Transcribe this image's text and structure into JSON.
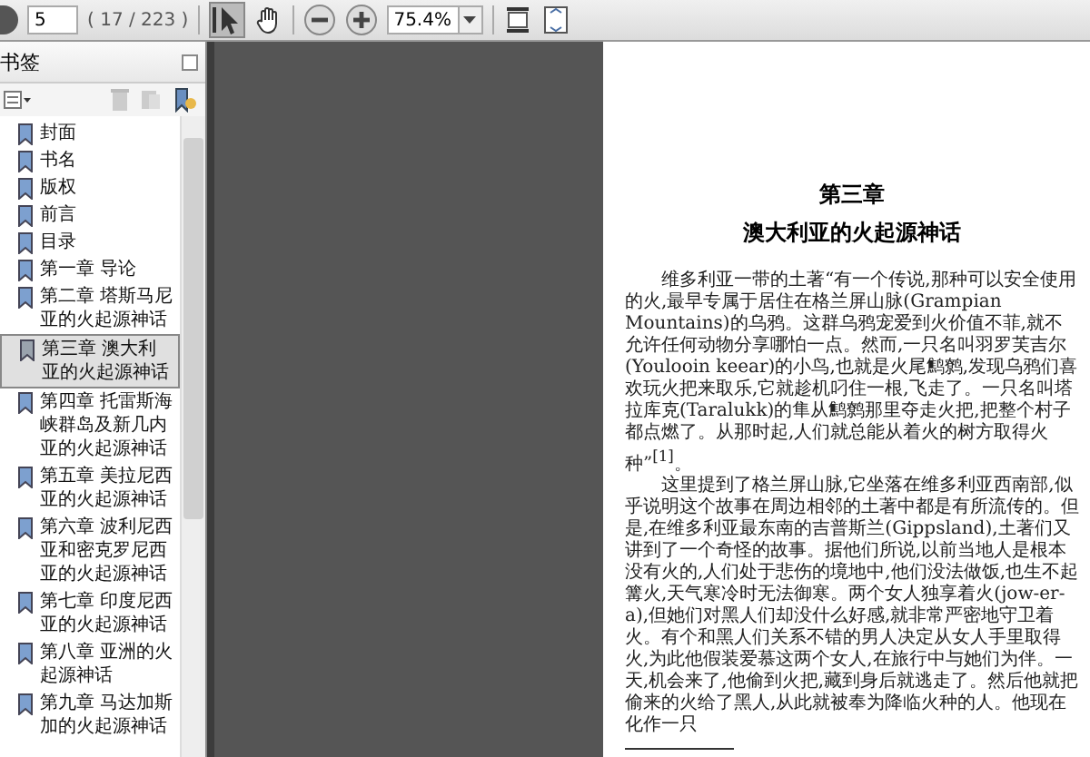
{
  "toolbar": {
    "page_field": {
      "value": "5"
    },
    "page_count": "( 17 / 223 )",
    "zoom_field": {
      "value": "75.4%"
    }
  },
  "sidebar": {
    "title": "书签",
    "items": [
      {
        "label": "封面",
        "selected": false
      },
      {
        "label": "书名",
        "selected": false
      },
      {
        "label": "版权",
        "selected": false
      },
      {
        "label": "前言",
        "selected": false
      },
      {
        "label": "目录",
        "selected": false
      },
      {
        "label": "第一章 导论",
        "selected": false
      },
      {
        "label": "第二章 塔斯马尼亚的火起源神话",
        "selected": false
      },
      {
        "label": "第三章 澳大利亚的火起源神话",
        "selected": true
      },
      {
        "label": "第四章 托雷斯海峡群岛及新几内亚的火起源神话",
        "selected": false
      },
      {
        "label": "第五章 美拉尼西亚的火起源神话",
        "selected": false
      },
      {
        "label": "第六章 波利尼西亚和密克罗尼西亚的火起源神话",
        "selected": false
      },
      {
        "label": "第七章 印度尼西亚的火起源神话",
        "selected": false
      },
      {
        "label": "第八章 亚洲的火起源神话",
        "selected": false
      },
      {
        "label": "第九章 马达加斯加的火起源神话",
        "selected": false
      }
    ]
  },
  "document": {
    "chapter": "第三章",
    "title": "澳大利亚的火起源神话",
    "paragraphs": [
      "维多利亚一带的土著“有一个传说,那种可以安全使用的火,最早专属于居住在格兰屏山脉(Grampian Mountains)的乌鸦。这群乌鸦宠爱到火价值不菲,就不允许任何动物分享哪怕一点。然而,一只名叫羽罗芙吉尔(Youlooin keear)的小鸟,也就是火尾鹪鹩,发现乌鸦们喜欢玩火把来取乐,它就趁机叼住一根,飞走了。一只名叫塔拉库克(Taralukk)的隼从鹪鹩那里夺走火把,把整个村子都点燃了。从那时起,人们就总能从着火的树方取得火种”$^{[1]}$。",
      "这里提到了格兰屏山脉,它坐落在维多利亚西南部,似乎说明这个故事在周边相邻的土著中都是有所流传的。但是,在维多利亚最东南的吉普斯兰(Gippsland),土著们又讲到了一个奇怪的故事。据他们所说,以前当地人是根本没有火的,人们处于悲伤的境地中,他们没法做饭,也生不起篝火,天气寒冷时无法御寒。两个女人独享着火(jow-er-a),但她们对黑人们却没什么好感,就非常严密地守卫着火。有个和黑人们关系不错的男人决定从女人手里取得火,为此他假装爱慕这两个女人,在旅行中与她们为伴。一天,机会来了,他偷到火把,藏到身后就逃走了。然后他就把偷来的火给了黑人,从此就被奉为降临火种的人。他现在化作一只"
    ]
  }
}
